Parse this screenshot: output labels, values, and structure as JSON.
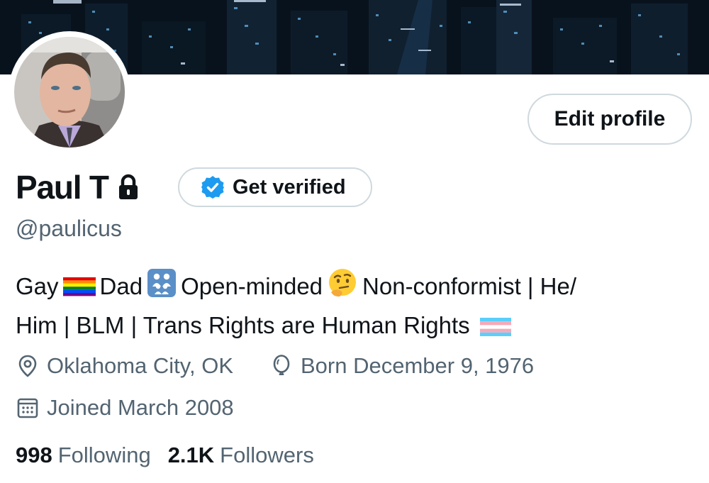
{
  "profile": {
    "display_name": "Paul T",
    "handle": "@paulicus",
    "edit_button_label": "Edit profile",
    "get_verified_label": "Get verified",
    "bio": {
      "line1": {
        "p1": "Gay",
        "p2": "Dad",
        "p3": "Open-minded",
        "p4": "Non-conformist | He/"
      },
      "line2": {
        "p1": "Him | BLM | Trans Rights are Human Rights"
      }
    },
    "location": "Oklahoma City, OK",
    "birthday": "Born December 9, 1976",
    "joined": "Joined March 2008",
    "following_count": "998",
    "following_label": "Following",
    "followers_count": "2.1K",
    "followers_label": "Followers"
  },
  "icons": {
    "lock": "lock-icon",
    "verified": "verified-badge-icon",
    "location": "location-pin-icon",
    "birthday": "balloon-icon",
    "calendar": "calendar-icon",
    "rainbow_flag": "rainbow-flag-emoji",
    "family": "family-emoji",
    "thinking": "thinking-face-emoji",
    "trans_flag": "transgender-flag-emoji"
  },
  "colors": {
    "text_primary": "#0f1419",
    "text_secondary": "#536471",
    "border": "#cfd9de",
    "verified_blue": "#1d9bf0"
  }
}
